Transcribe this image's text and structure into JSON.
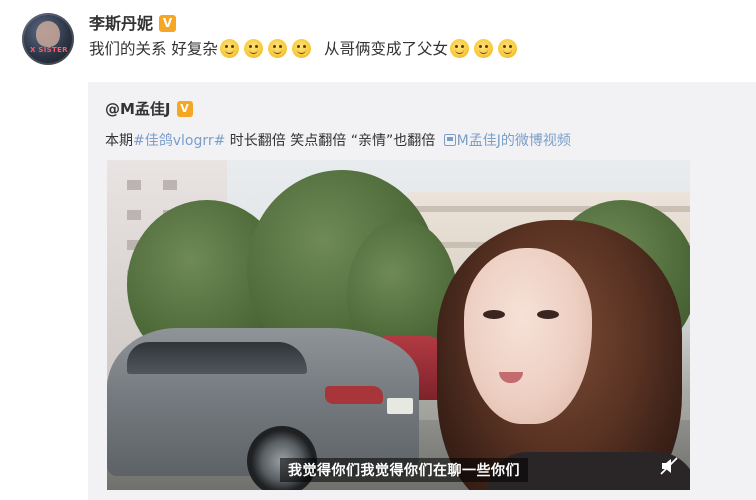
{
  "post": {
    "avatar_label": "X SISTER",
    "username": "李斯丹妮",
    "verified_badge": "V",
    "text_part1": "我们的关系 好复杂",
    "text_part2": "从哥俩变成了父女",
    "emoji_icon": "smiley-emoji-icon"
  },
  "repost": {
    "username": "@M孟佳J",
    "verified_badge": "V",
    "text_prefix": "本期",
    "topic": "#佳鸽vlogrr#",
    "text_body": " 时长翻倍 笑点翻倍 “亲情”也翻倍 ",
    "link_text": "M孟佳J的微博视频",
    "video": {
      "subtitle": "我觉得你们我觉得你们在聊一些你们",
      "mute_icon": "mute-icon"
    }
  },
  "colors": {
    "link": "#7b9ec9",
    "badge": "#f5a623",
    "repost_bg": "#f2f2f5"
  }
}
